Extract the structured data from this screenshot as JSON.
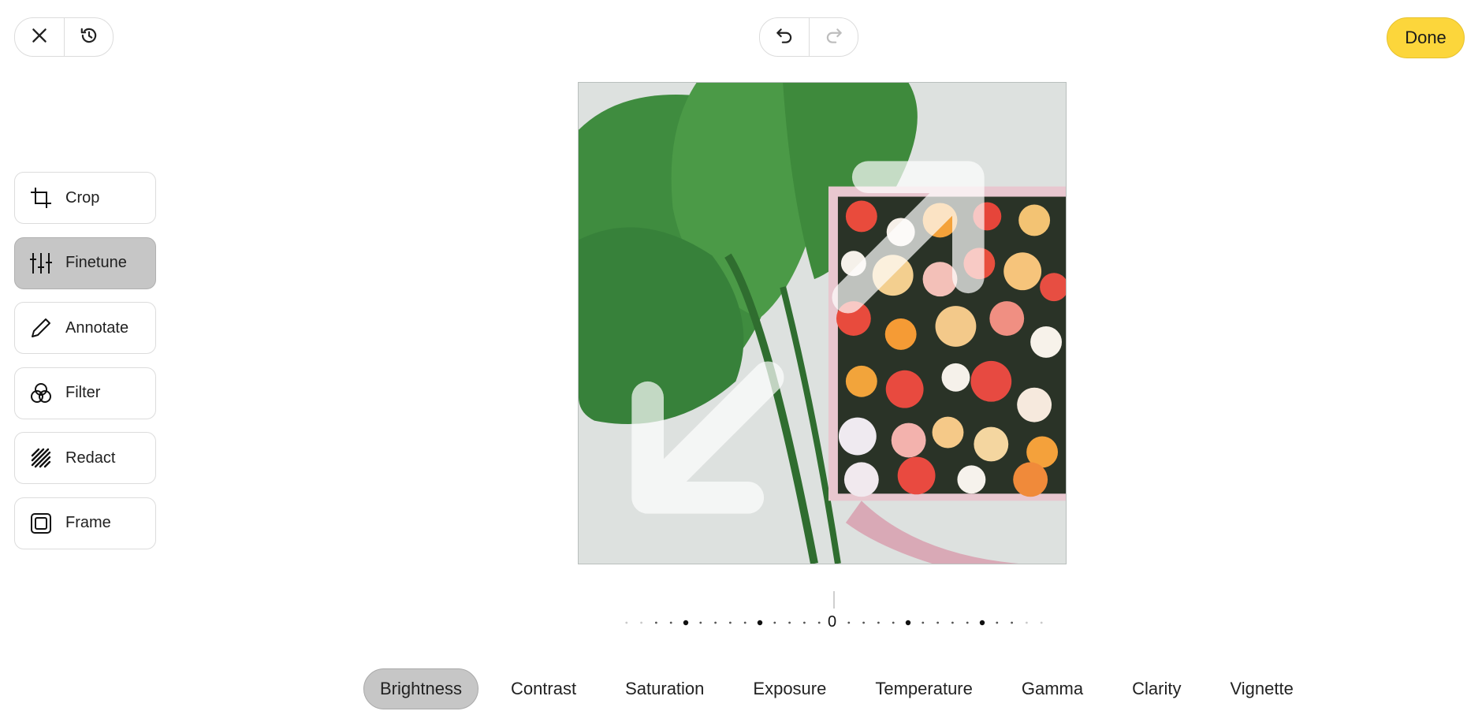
{
  "header": {
    "close_icon": "close-icon",
    "history_icon": "history-icon",
    "undo_icon": "undo-icon",
    "redo_icon": "redo-icon",
    "done_label": "Done",
    "done_color": "#fcd63b"
  },
  "tools": [
    {
      "label": "Crop",
      "icon": "crop-icon",
      "active": false
    },
    {
      "label": "Finetune",
      "icon": "sliders-icon",
      "active": true
    },
    {
      "label": "Annotate",
      "icon": "pencil-icon",
      "active": false
    },
    {
      "label": "Filter",
      "icon": "filter-circles-icon",
      "active": false
    },
    {
      "label": "Redact",
      "icon": "redact-hatch-icon",
      "active": false
    },
    {
      "label": "Frame",
      "icon": "frame-icon",
      "active": false
    }
  ],
  "slider": {
    "value": "0"
  },
  "adjustments": [
    {
      "label": "Brightness",
      "active": true
    },
    {
      "label": "Contrast",
      "active": false
    },
    {
      "label": "Saturation",
      "active": false
    },
    {
      "label": "Exposure",
      "active": false
    },
    {
      "label": "Temperature",
      "active": false
    },
    {
      "label": "Gamma",
      "active": false
    },
    {
      "label": "Clarity",
      "active": false
    },
    {
      "label": "Vignette",
      "active": false
    }
  ]
}
